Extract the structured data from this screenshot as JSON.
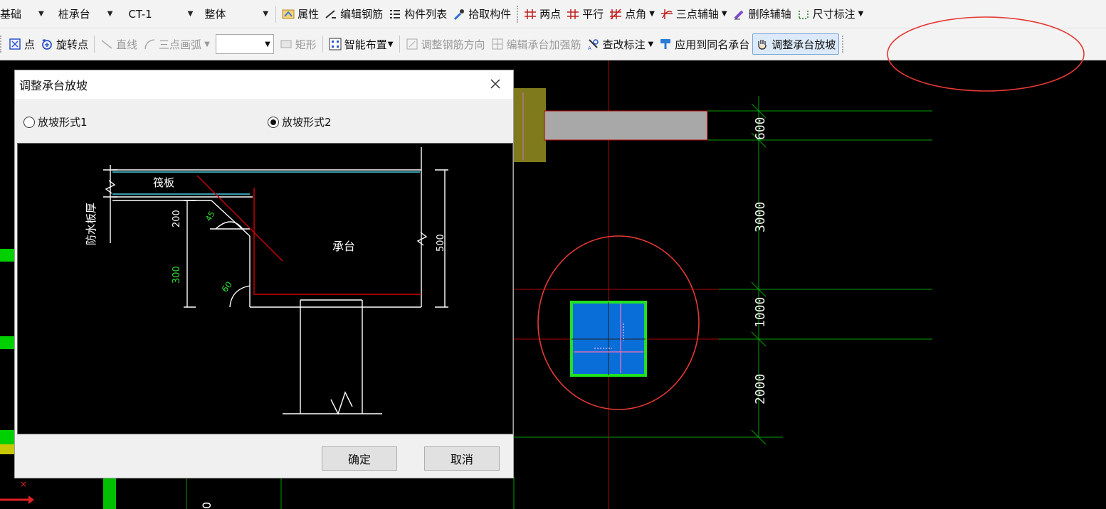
{
  "toolbar1": {
    "combo_category": "基础",
    "combo_type": "桩承台",
    "combo_name": "CT-1",
    "combo_scope": "整体",
    "btn_property": "属性",
    "btn_edit_rebar": "编辑钢筋",
    "btn_component_list": "构件列表",
    "btn_pick_component": "拾取构件",
    "btn_two_points": "两点",
    "btn_parallel": "平行",
    "btn_point_angle": "点角",
    "btn_three_point_axis": "三点辅轴",
    "btn_delete_axis": "删除辅轴",
    "btn_dimension": "尺寸标注"
  },
  "toolbar2": {
    "btn_point": "点",
    "btn_rotate_point": "旋转点",
    "btn_line": "直线",
    "btn_three_point_arc": "三点画弧",
    "btn_rect": "矩形",
    "btn_smart_layout": "智能布置",
    "btn_adjust_rebar_dir": "调整钢筋方向",
    "btn_edit_cap_rebar": "编辑承台加强筋",
    "btn_check_annotation": "查改标注",
    "btn_apply_same_cap": "应用到同名承台",
    "btn_adjust_cap_slope": "调整承台放坡"
  },
  "canvas": {
    "dims": [
      "600",
      "3000",
      "1000",
      "2000"
    ],
    "bottom_label": "0"
  },
  "dialog": {
    "title": "调整承台放坡",
    "radio1": "放坡形式1",
    "radio2": "放坡形式2",
    "selected": "放坡形式2",
    "preview": {
      "label_raft": "筏板",
      "label_cap": "承台",
      "label_waterproof": "防水板厚",
      "dim_200": "200",
      "dim_300": "300",
      "dim_500": "500",
      "angle_45": "45",
      "angle_60": "60"
    },
    "ok": "确定",
    "cancel": "取消"
  },
  "colors": {
    "grid_green": "#00b400",
    "grid_red": "#b00000",
    "cap_blue": "#0a6ed8",
    "highlight_red": "#e53935"
  }
}
